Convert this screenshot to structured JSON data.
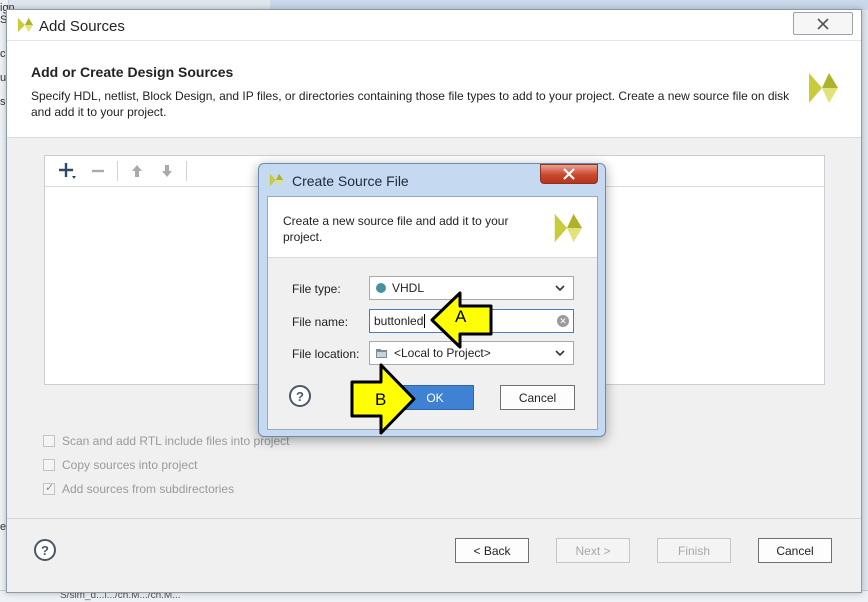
{
  "background": {
    "left_fragments": [
      "ign Sources",
      "c",
      "u",
      "s",
      "e"
    ],
    "bottom_path_fragment": "S/sim_d...i.../ch.M.../ch.M..."
  },
  "dialog": {
    "title": "Add Sources",
    "header_title": "Add or Create Design Sources",
    "header_desc": "Specify HDL, netlist, Block Design, and IP files, or directories containing those file types to add to your project. Create a new source file on disk and add it to your project.",
    "options": [
      {
        "label": "Scan and add RTL include files into project",
        "checked": false
      },
      {
        "label": "Copy sources into project",
        "checked": false
      },
      {
        "label": "Add sources from subdirectories",
        "checked": true
      }
    ],
    "buttons": {
      "back": "< Back",
      "next": "Next >",
      "finish": "Finish",
      "cancel": "Cancel",
      "help": "?"
    }
  },
  "create_source": {
    "title": "Create Source File",
    "desc": "Create a new source file and add it to your project.",
    "file_type_label": "File type:",
    "file_type_value": "VHDL",
    "file_name_label": "File name:",
    "file_name_value": "buttonled",
    "file_location_label": "File location:",
    "file_location_value": "<Local to Project>",
    "ok": "OK",
    "cancel": "Cancel",
    "help": "?"
  },
  "annotations": {
    "a": "A",
    "b": "B"
  },
  "colors": {
    "accent_blue": "#3f81d2",
    "vhdl_dot": "#4b8fa5",
    "arrow_yellow": "#ffff00",
    "logo_yellow": "#c9cc3a"
  }
}
